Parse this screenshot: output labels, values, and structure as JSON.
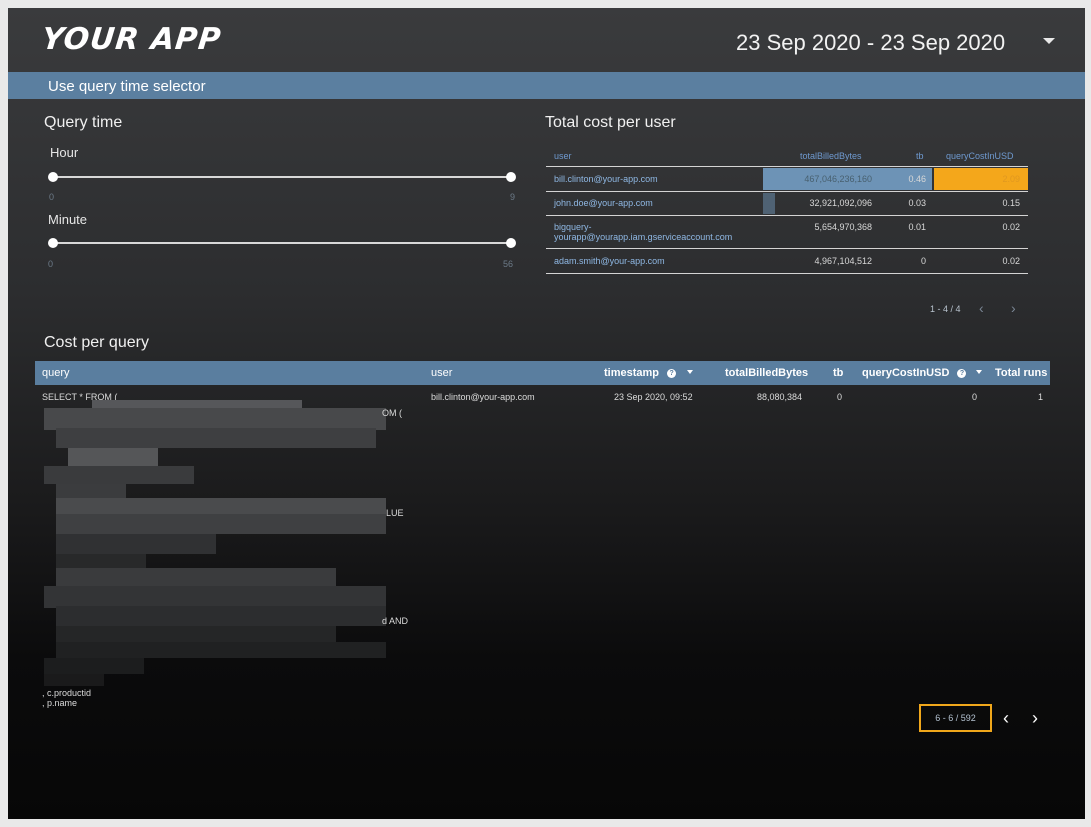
{
  "header": {
    "app_name": "YOUR APP",
    "date_range": "23 Sep 2020 - 23 Sep 2020"
  },
  "banner": {
    "title": "Use query time selector"
  },
  "query_time": {
    "title": "Query time",
    "hour": {
      "label": "Hour",
      "min": "0",
      "max": "9"
    },
    "minute": {
      "label": "Minute",
      "min": "0",
      "max": "56"
    }
  },
  "user_cost": {
    "title": "Total cost per user",
    "columns": [
      "user",
      "totalBilledBytes",
      "tb",
      "queryCostInUSD"
    ],
    "rows": [
      {
        "user": "bill.clinton@your-app.com",
        "bytes": "467,046,236,160",
        "tb": "0.46",
        "cost": "2.09",
        "bytes_fraction": 1.0,
        "cost_fraction": 1.0
      },
      {
        "user": "john.doe@your-app.com",
        "bytes": "32,921,092,096",
        "tb": "0.03",
        "cost": "0.15",
        "bytes_fraction": 0.07,
        "cost_fraction": 0.07
      },
      {
        "user_line1": "bigquery-",
        "user_line2": "yourapp@yourapp.iam.gserviceaccount.com",
        "bytes": "5,654,970,368",
        "tb": "0.01",
        "cost": "0.02"
      },
      {
        "user": "adam.smith@your-app.com",
        "bytes": "4,967,104,512",
        "tb": "0",
        "cost": "0.02"
      }
    ],
    "pager": "1 - 4 / 4"
  },
  "queries": {
    "title": "Cost per query",
    "columns": {
      "query": "query",
      "user": "user",
      "timestamp": "timestamp",
      "bytes": "totalBilledBytes",
      "tb": "tb",
      "cost": "queryCostInUSD",
      "runs": "Total runs"
    },
    "row": {
      "query_start": "SELECT * FROM (",
      "frag_1": "OM (",
      "frag_2": "LUE",
      "frag_3": "d AND",
      "frag_4": ", c.productid",
      "frag_5": ", p.name",
      "user": "bill.clinton@your-app.com",
      "timestamp": "23 Sep 2020, 09:52",
      "bytes": "88,080,384",
      "tb": "0",
      "cost": "0",
      "runs": "1"
    },
    "pager": "6 - 6 / 592"
  },
  "icons": {
    "info": "info-icon",
    "sort": "sort-desc-icon",
    "prev": "chevron-left-icon",
    "next": "chevron-right-icon",
    "dropdown": "caret-down-icon"
  }
}
